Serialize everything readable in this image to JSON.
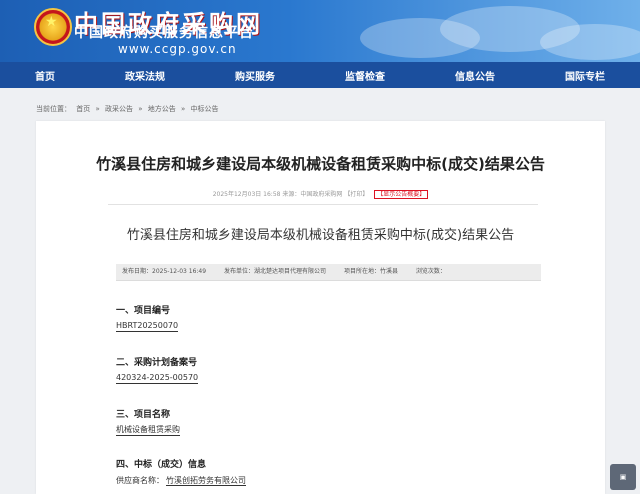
{
  "header": {
    "site_title": "中国政府采购网",
    "site_subtitle": "中国政府购买服务信息平台",
    "site_url": "www.ccgp.gov.cn"
  },
  "nav": [
    "首页",
    "政采法规",
    "购买服务",
    "监督检查",
    "信息公告",
    "国际专栏"
  ],
  "breadcrumb": [
    "当前位置：",
    "首页",
    "»",
    "政采公告",
    "»",
    "地方公告",
    "»",
    "中标公告"
  ],
  "article": {
    "title": "竹溪县住房和城乡建设局本级机械设备租赁采购中标(成交)结果公告",
    "meta_time": "2025年12月03日 16:58",
    "meta_source": "来源：中国政府采购网",
    "meta_print": "【打印】",
    "meta_tag": "【显示公告概要】",
    "subtitle": "竹溪县住房和城乡建设局本级机械设备租赁采购中标(成交)结果公告",
    "info_bar": {
      "publish_date": "发布日期：2025-12-03 16:49",
      "publisher": "发布单位：湖北楚达项目代理有限公司",
      "district": "项目所在地：竹溪县",
      "views": "浏览次数："
    },
    "sections": {
      "s1_heading": "一、项目编号",
      "s1_value": "HBRT20250070",
      "s2_heading": "二、采购计划备案号",
      "s2_value": "420324-2025-00570",
      "s3_heading": "三、项目名称",
      "s3_value": "机械设备租赁采购",
      "s4_heading": "四、中标（成交）信息",
      "s4_label": "供应商名称：",
      "s4_value": "竹溪创拓劳务有限公司"
    }
  },
  "colors": {
    "banner_blue": "#2a78cf",
    "nav_blue": "#1b4f9e",
    "tag_red": "#dd1122"
  }
}
